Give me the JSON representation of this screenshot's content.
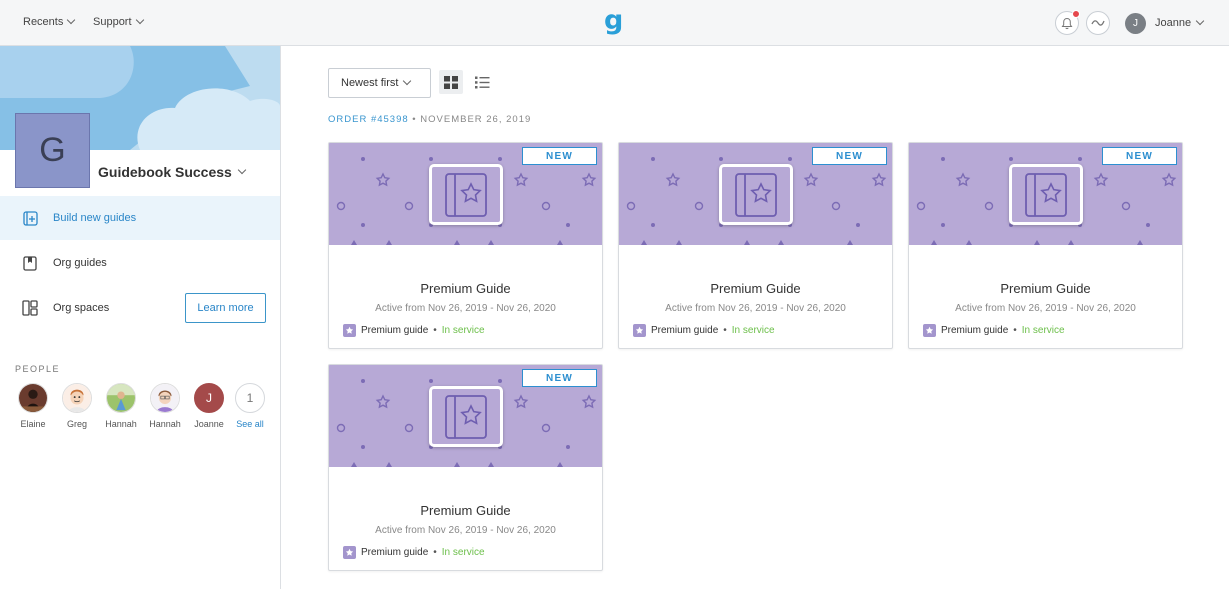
{
  "topbar": {
    "recents_label": "Recents",
    "support_label": "Support",
    "logo_text": "g",
    "user_initial": "J",
    "user_name": "Joanne"
  },
  "sidebar": {
    "org_initial": "G",
    "org_name": "Guidebook Success",
    "menu": [
      {
        "label": "Build new guides",
        "icon": "add-guide-icon",
        "active": true
      },
      {
        "label": "Org guides",
        "icon": "bookmark-icon",
        "active": false
      },
      {
        "label": "Org spaces",
        "icon": "spaces-icon",
        "active": false
      }
    ],
    "learn_more_label": "Learn more",
    "people_title": "PEOPLE",
    "people": [
      {
        "name": "Elaine"
      },
      {
        "name": "Greg"
      },
      {
        "name": "Hannah"
      },
      {
        "name": "Hannah"
      },
      {
        "name": "Joanne",
        "initial": "J"
      },
      {
        "name": "See all",
        "count": "1"
      }
    ]
  },
  "main": {
    "sort_label": "Newest first",
    "order_id": "ORDER #45398",
    "order_sep": " • ",
    "order_date": "NOVEMBER 26, 2019",
    "cards": [
      {
        "badge": "NEW",
        "title": "Premium Guide",
        "dates": "Active from Nov 26, 2019 - Nov 26, 2020",
        "type": "Premium guide",
        "status": "In service"
      },
      {
        "badge": "NEW",
        "title": "Premium Guide",
        "dates": "Active from Nov 26, 2019 - Nov 26, 2020",
        "type": "Premium guide",
        "status": "In service"
      },
      {
        "badge": "NEW",
        "title": "Premium Guide",
        "dates": "Active from Nov 26, 2019 - Nov 26, 2020",
        "type": "Premium guide",
        "status": "In service"
      },
      {
        "badge": "NEW",
        "title": "Premium Guide",
        "dates": "Active from Nov 26, 2019 - Nov 26, 2020",
        "type": "Premium guide",
        "status": "In service"
      }
    ]
  },
  "colors": {
    "accent": "#2a86c8",
    "card_art": "#b7a9d6",
    "status_green": "#6cbf4a"
  }
}
